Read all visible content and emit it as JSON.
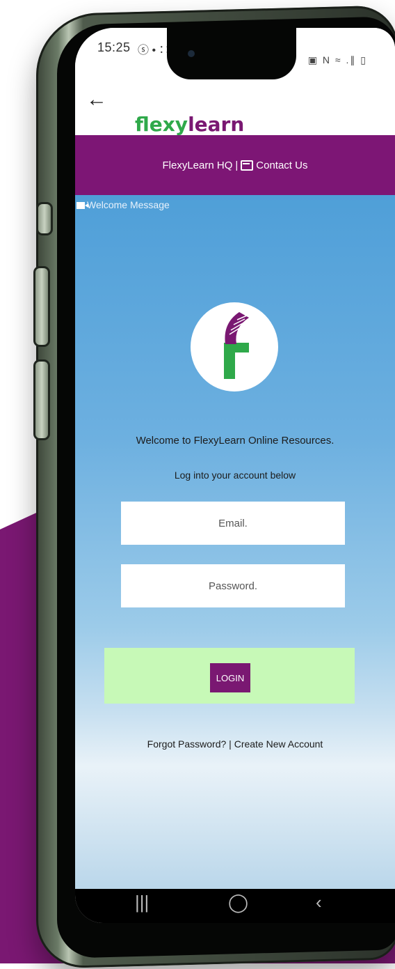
{
  "status_bar": {
    "time": "15:25",
    "left_icons": "ⓢ • ∷",
    "right_icons": "▣ N ≈ .∥ ▯"
  },
  "header": {
    "back_icon": "←",
    "brand_part1": "flexy",
    "brand_part2": "learn"
  },
  "nav": {
    "hq_label": "FlexyLearn HQ",
    "separator": "|",
    "contact_label": "Contact Us"
  },
  "welcome": {
    "video_label": "Welcome Message"
  },
  "main": {
    "welcome_text": "Welcome to FlexyLearn Online Resources.",
    "login_prompt": "Log into your account below",
    "email_placeholder": "Email.",
    "password_placeholder": "Password.",
    "login_button": "LOGIN"
  },
  "links": {
    "forgot": "Forgot Password?",
    "separator": " | ",
    "create": "Create New Account"
  },
  "system_nav": {
    "recents": "|||",
    "home": "◯",
    "back": "‹"
  },
  "colors": {
    "purple": "#7a1872",
    "green": "#2fa94a",
    "login_band": "#c7f9b7"
  }
}
